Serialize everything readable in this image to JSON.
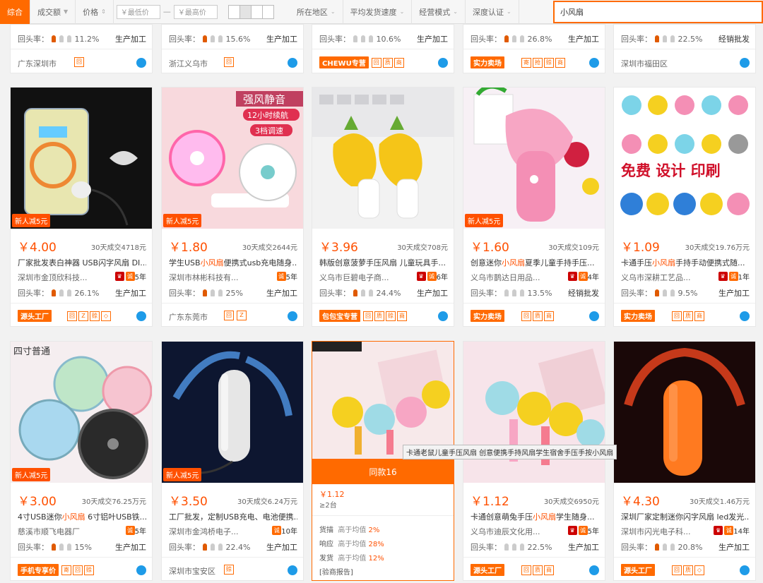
{
  "filters": {
    "composite": "综合",
    "volume": "成交额",
    "price": "价格",
    "min_price_placeholder": "￥最低价",
    "max_price_placeholder": "￥最高价",
    "dash": "—",
    "region": "所在地区",
    "ship_speed": "平均发货速度",
    "mode": "经营模式",
    "depth": "深度认证",
    "search_value": "小风扇"
  },
  "top_row": [
    {
      "rr": "11.2%",
      "type": "生产加工",
      "loc": "广东深圳市"
    },
    {
      "rr": "15.6%",
      "type": "生产加工",
      "loc": "浙江义乌市"
    },
    {
      "rr": "10.6%",
      "type": "生产加工",
      "tag": "CHEWU专营"
    },
    {
      "rr": "26.8%",
      "type": "生产加工",
      "tag": "实力卖场"
    },
    {
      "rr": "22.5%",
      "type": "经销批发",
      "loc": "深圳市福田区"
    }
  ],
  "label_rr": "回头率：",
  "products": [
    {
      "price": "￥4.00",
      "sales": "30天成交4718元",
      "title": "厂家批发表白神器 USB闪字风扇 DI...",
      "shop": "深圳市金顶欣科技...",
      "years": "5年",
      "rr": "26.1%",
      "type": "生产加工",
      "tag": "源头工厂",
      "new": "新人减5元"
    },
    {
      "price": "￥1.80",
      "sales": "30天成交2644元",
      "title_pre": "学生USB",
      "title_hl": "小风扇",
      "title_post": "便携式usb充电随身...",
      "shop": "深圳市林彬科技有...",
      "years": "5年",
      "rr": "25%",
      "type": "生产加工",
      "loc": "广东东莞市",
      "new": "新人减5元"
    },
    {
      "price": "￥3.96",
      "sales": "30天成交708元",
      "title": "韩版创意菠萝手压风扇 儿童玩具手...",
      "shop": "义乌市巨碧电子商...",
      "years": "6年",
      "rr": "24.4%",
      "type": "生产加工",
      "tag": "包包宝专营"
    },
    {
      "price": "￥1.60",
      "sales": "30天成交109元",
      "title_pre": "创意迷你",
      "title_hl": "小风扇",
      "title_post": "夏季儿童手持手压...",
      "shop": "义乌市鹊达日用品...",
      "years": "4年",
      "rr": "13.5%",
      "type": "经销批发",
      "tag": "实力卖场",
      "new": "新人减5元"
    },
    {
      "price": "￥1.09",
      "sales": "30天成交19.76万元",
      "title_pre": "卡通手压",
      "title_hl": "小风扇",
      "title_post": "手持手动便携式随...",
      "shop": "义乌市深耕工艺品...",
      "years": "1年",
      "rr": "9.5%",
      "type": "生产加工",
      "tag": "实力卖场"
    },
    {
      "price": "￥3.00",
      "sales": "30天成交76.25万元",
      "title_pre": "4寸USB迷你",
      "title_hl": "小风扇",
      "title_post": " 6寸铝叶USB铁...",
      "shop": "慈溪市顺飞电器厂",
      "years": "5年",
      "rr": "15%",
      "type": "生产加工",
      "tag": "手机专享价",
      "new": "新人减5元"
    },
    {
      "price": "￥3.50",
      "sales": "30天成交6.24万元",
      "title": "工厂批发，定制USB充电、电池便携...",
      "shop": "深圳市金鸿桥电子...",
      "years": "10年",
      "rr": "22.4%",
      "type": "生产加工",
      "loc": "深圳市宝安区",
      "new": "新人减5元"
    },
    {
      "price": "￥1.12",
      "sales": "30天成交6950元",
      "title_pre": "卡通创意萌兔手压",
      "title_hl": "小风扇",
      "title_post": "学生随身...",
      "shop": "义乌市迪辰文化用...",
      "years": "5年",
      "rr": "22.5%",
      "type": "生产加工",
      "tag": "源头工厂"
    },
    {
      "price": "￥4.30",
      "sales": "30天成交1.46万元",
      "title": "深圳厂家定制迷你闪字风扇 led发光...",
      "shop": "深圳市闪光电子科...",
      "years": "14年",
      "rr": "20.8%",
      "type": "生产加工",
      "tag": "源头工厂"
    }
  ],
  "hover_card": {
    "band": "同款16",
    "price": "￥1.12",
    "moq": "≥2台",
    "m1_label": "货描",
    "m1_text": "高于均值",
    "m1_val": "2%",
    "m2_label": "响应",
    "m2_text": "高于均值",
    "m2_val": "28%",
    "m3_label": "发货",
    "m3_text": "高于均值",
    "m3_val": "12%",
    "report": "[验商报告]"
  },
  "tooltip": "卡通老鼠儿童手压风扇 创意便携手持风扇学生宿舍手压手按小风扇",
  "image_texts": {
    "p2_a": "强风静音",
    "p2_b": "12小时续航",
    "p2_c": "3档调速",
    "p5": "免费 设计 印刷",
    "p6": "四寸普通"
  },
  "colors": {
    "accent": "#ff6a00",
    "price": "#ff5000",
    "link": "#1e9be8"
  }
}
